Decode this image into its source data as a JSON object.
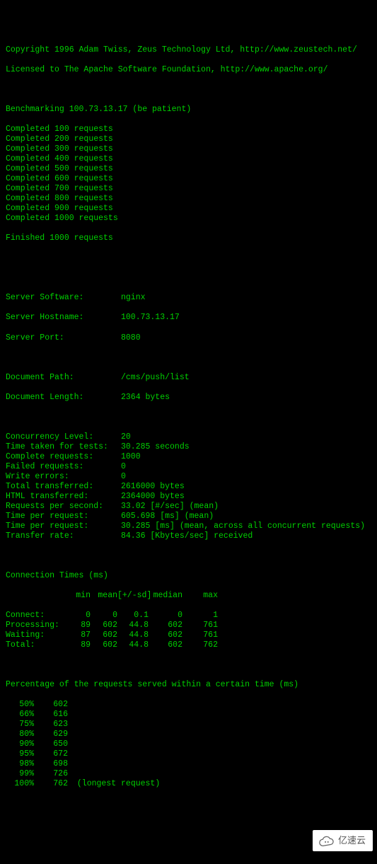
{
  "copyright": "Copyright 1996 Adam Twiss, Zeus Technology Ltd, http://www.zeustech.net/",
  "license": "Licensed to The Apache Software Foundation, http://www.apache.org/",
  "bench_line": "Benchmarking 100.73.13.17 (be patient)",
  "completed": [
    "Completed 100 requests",
    "Completed 200 requests",
    "Completed 300 requests",
    "Completed 400 requests",
    "Completed 500 requests",
    "Completed 600 requests",
    "Completed 700 requests",
    "Completed 800 requests",
    "Completed 900 requests",
    "Completed 1000 requests"
  ],
  "finished": "Finished 1000 requests",
  "server": {
    "software_l": "Server Software:",
    "software_v": "nginx",
    "host_l": "Server Hostname:",
    "host_v": "100.73.13.17",
    "port_l": "Server Port:",
    "port_v": "8080"
  },
  "doc": {
    "path_l": "Document Path:",
    "path_v": "/cms/push/list",
    "len_l": "Document Length:",
    "len_v": "2364 bytes"
  },
  "stats": [
    {
      "l": "Concurrency Level:",
      "v": "20"
    },
    {
      "l": "Time taken for tests:",
      "v": "30.285 seconds"
    },
    {
      "l": "Complete requests:",
      "v": "1000"
    },
    {
      "l": "Failed requests:",
      "v": "0"
    },
    {
      "l": "Write errors:",
      "v": "0"
    },
    {
      "l": "Total transferred:",
      "v": "2616000 bytes"
    },
    {
      "l": "HTML transferred:",
      "v": "2364000 bytes"
    },
    {
      "l": "Requests per second:",
      "v": "33.02 [#/sec] (mean)"
    },
    {
      "l": "Time per request:",
      "v": "605.698 [ms] (mean)"
    },
    {
      "l": "Time per request:",
      "v": "30.285 [ms] (mean, across all concurrent requests)"
    },
    {
      "l": "Transfer rate:",
      "v": "84.36 [Kbytes/sec] received"
    }
  ],
  "ct_title": "Connection Times (ms)",
  "ct_hdr": {
    "min": "min",
    "mean": "mean",
    "sd": "[+/-sd]",
    "median": "median",
    "max": "max"
  },
  "ct_rows": [
    {
      "name": "Connect:",
      "min": "0",
      "mean": "0",
      "sd": "0.1",
      "median": "0",
      "max": "1"
    },
    {
      "name": "Processing:",
      "min": "89",
      "mean": "602",
      "sd": "44.8",
      "median": "602",
      "max": "761"
    },
    {
      "name": "Waiting:",
      "min": "87",
      "mean": "602",
      "sd": "44.8",
      "median": "602",
      "max": "761"
    },
    {
      "name": "Total:",
      "min": "89",
      "mean": "602",
      "sd": "44.8",
      "median": "602",
      "max": "762"
    }
  ],
  "pct_title": "Percentage of the requests served within a certain time (ms)",
  "pct": [
    {
      "p": "50%",
      "v": "602",
      "note": ""
    },
    {
      "p": "66%",
      "v": "616",
      "note": ""
    },
    {
      "p": "75%",
      "v": "623",
      "note": ""
    },
    {
      "p": "80%",
      "v": "629",
      "note": ""
    },
    {
      "p": "90%",
      "v": "650",
      "note": ""
    },
    {
      "p": "95%",
      "v": "672",
      "note": ""
    },
    {
      "p": "98%",
      "v": "698",
      "note": ""
    },
    {
      "p": "99%",
      "v": "726",
      "note": ""
    },
    {
      "p": "100%",
      "v": "762",
      "note": "(longest request)"
    }
  ],
  "chart_data": {
    "type": "table",
    "title": "ApacheBench result",
    "connection_times_ms": {
      "headers": [
        "min",
        "mean",
        "+/-sd",
        "median",
        "max"
      ],
      "rows": {
        "Connect": [
          0,
          0,
          0.1,
          0,
          1
        ],
        "Processing": [
          89,
          602,
          44.8,
          602,
          761
        ],
        "Waiting": [
          87,
          602,
          44.8,
          602,
          761
        ],
        "Total": [
          89,
          602,
          44.8,
          602,
          762
        ]
      }
    },
    "percentiles_ms": {
      "50": 602,
      "66": 616,
      "75": 623,
      "80": 629,
      "90": 650,
      "95": 672,
      "98": 698,
      "99": 726,
      "100": 762
    }
  },
  "watermark": "亿速云"
}
